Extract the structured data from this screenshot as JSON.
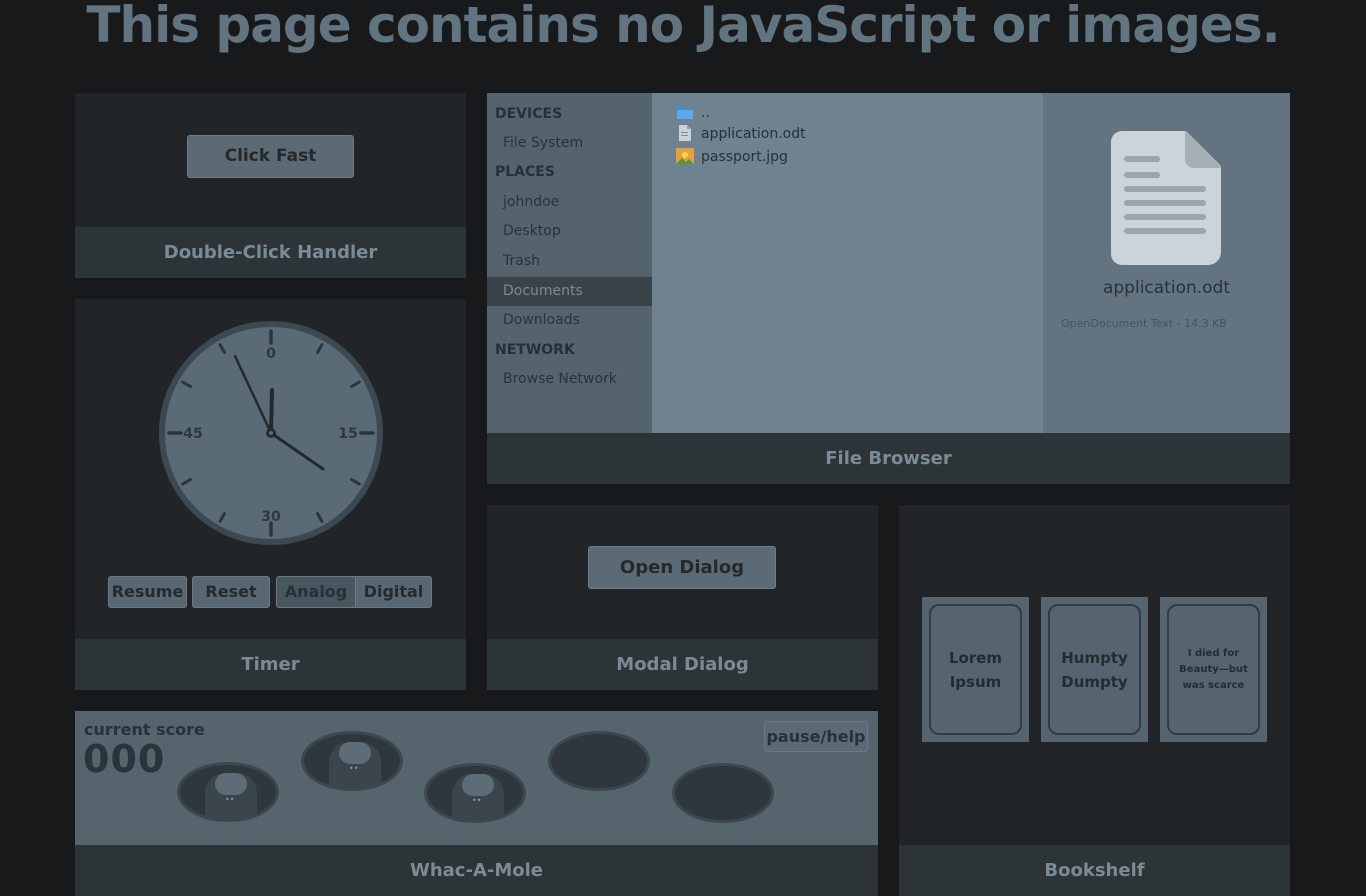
{
  "headline": "This page contains no JavaScript or images.",
  "double_click": {
    "button_label": "Click Fast",
    "footer": "Double-Click Handler"
  },
  "timer": {
    "footer": "Timer",
    "dial_labels": {
      "top": "0",
      "right": "15",
      "bottom": "30",
      "left": "45"
    },
    "buttons": {
      "resume": "Resume",
      "reset": "Reset",
      "analog": "Analog",
      "digital": "Digital"
    },
    "active_mode": "Analog"
  },
  "file_browser": {
    "footer": "File Browser",
    "sidebar": {
      "devices_heading": "DEVICES",
      "devices": [
        "File System"
      ],
      "places_heading": "PLACES",
      "places": [
        "johndoe",
        "Desktop",
        "Trash",
        "Documents",
        "Downloads"
      ],
      "selected_place": "Documents",
      "network_heading": "NETWORK",
      "network": [
        "Browse Network"
      ]
    },
    "files": [
      {
        "name": "..",
        "icon": "folder-icon"
      },
      {
        "name": "application.odt",
        "icon": "document-icon"
      },
      {
        "name": "passport.jpg",
        "icon": "image-icon"
      }
    ],
    "detail": {
      "name": "application.odt",
      "meta": "OpenDocument Text - 14.3 KB"
    }
  },
  "modal": {
    "button_label": "Open Dialog",
    "footer": "Modal Dialog"
  },
  "bookshelf": {
    "footer": "Bookshelf",
    "books": [
      {
        "title": "Lorem Ipsum"
      },
      {
        "title": "Humpty Dumpty"
      },
      {
        "title": "I died for Beauty—but was scarce"
      }
    ]
  },
  "whac_a_mole": {
    "footer": "Whac-A-Mole",
    "score_label": "current score",
    "score": "000",
    "pause_label": "pause/help"
  },
  "colors": {
    "background": "#17191b",
    "panel": "#212528",
    "footer": "#2d3438",
    "accent_folder": "#3a8fd8"
  }
}
